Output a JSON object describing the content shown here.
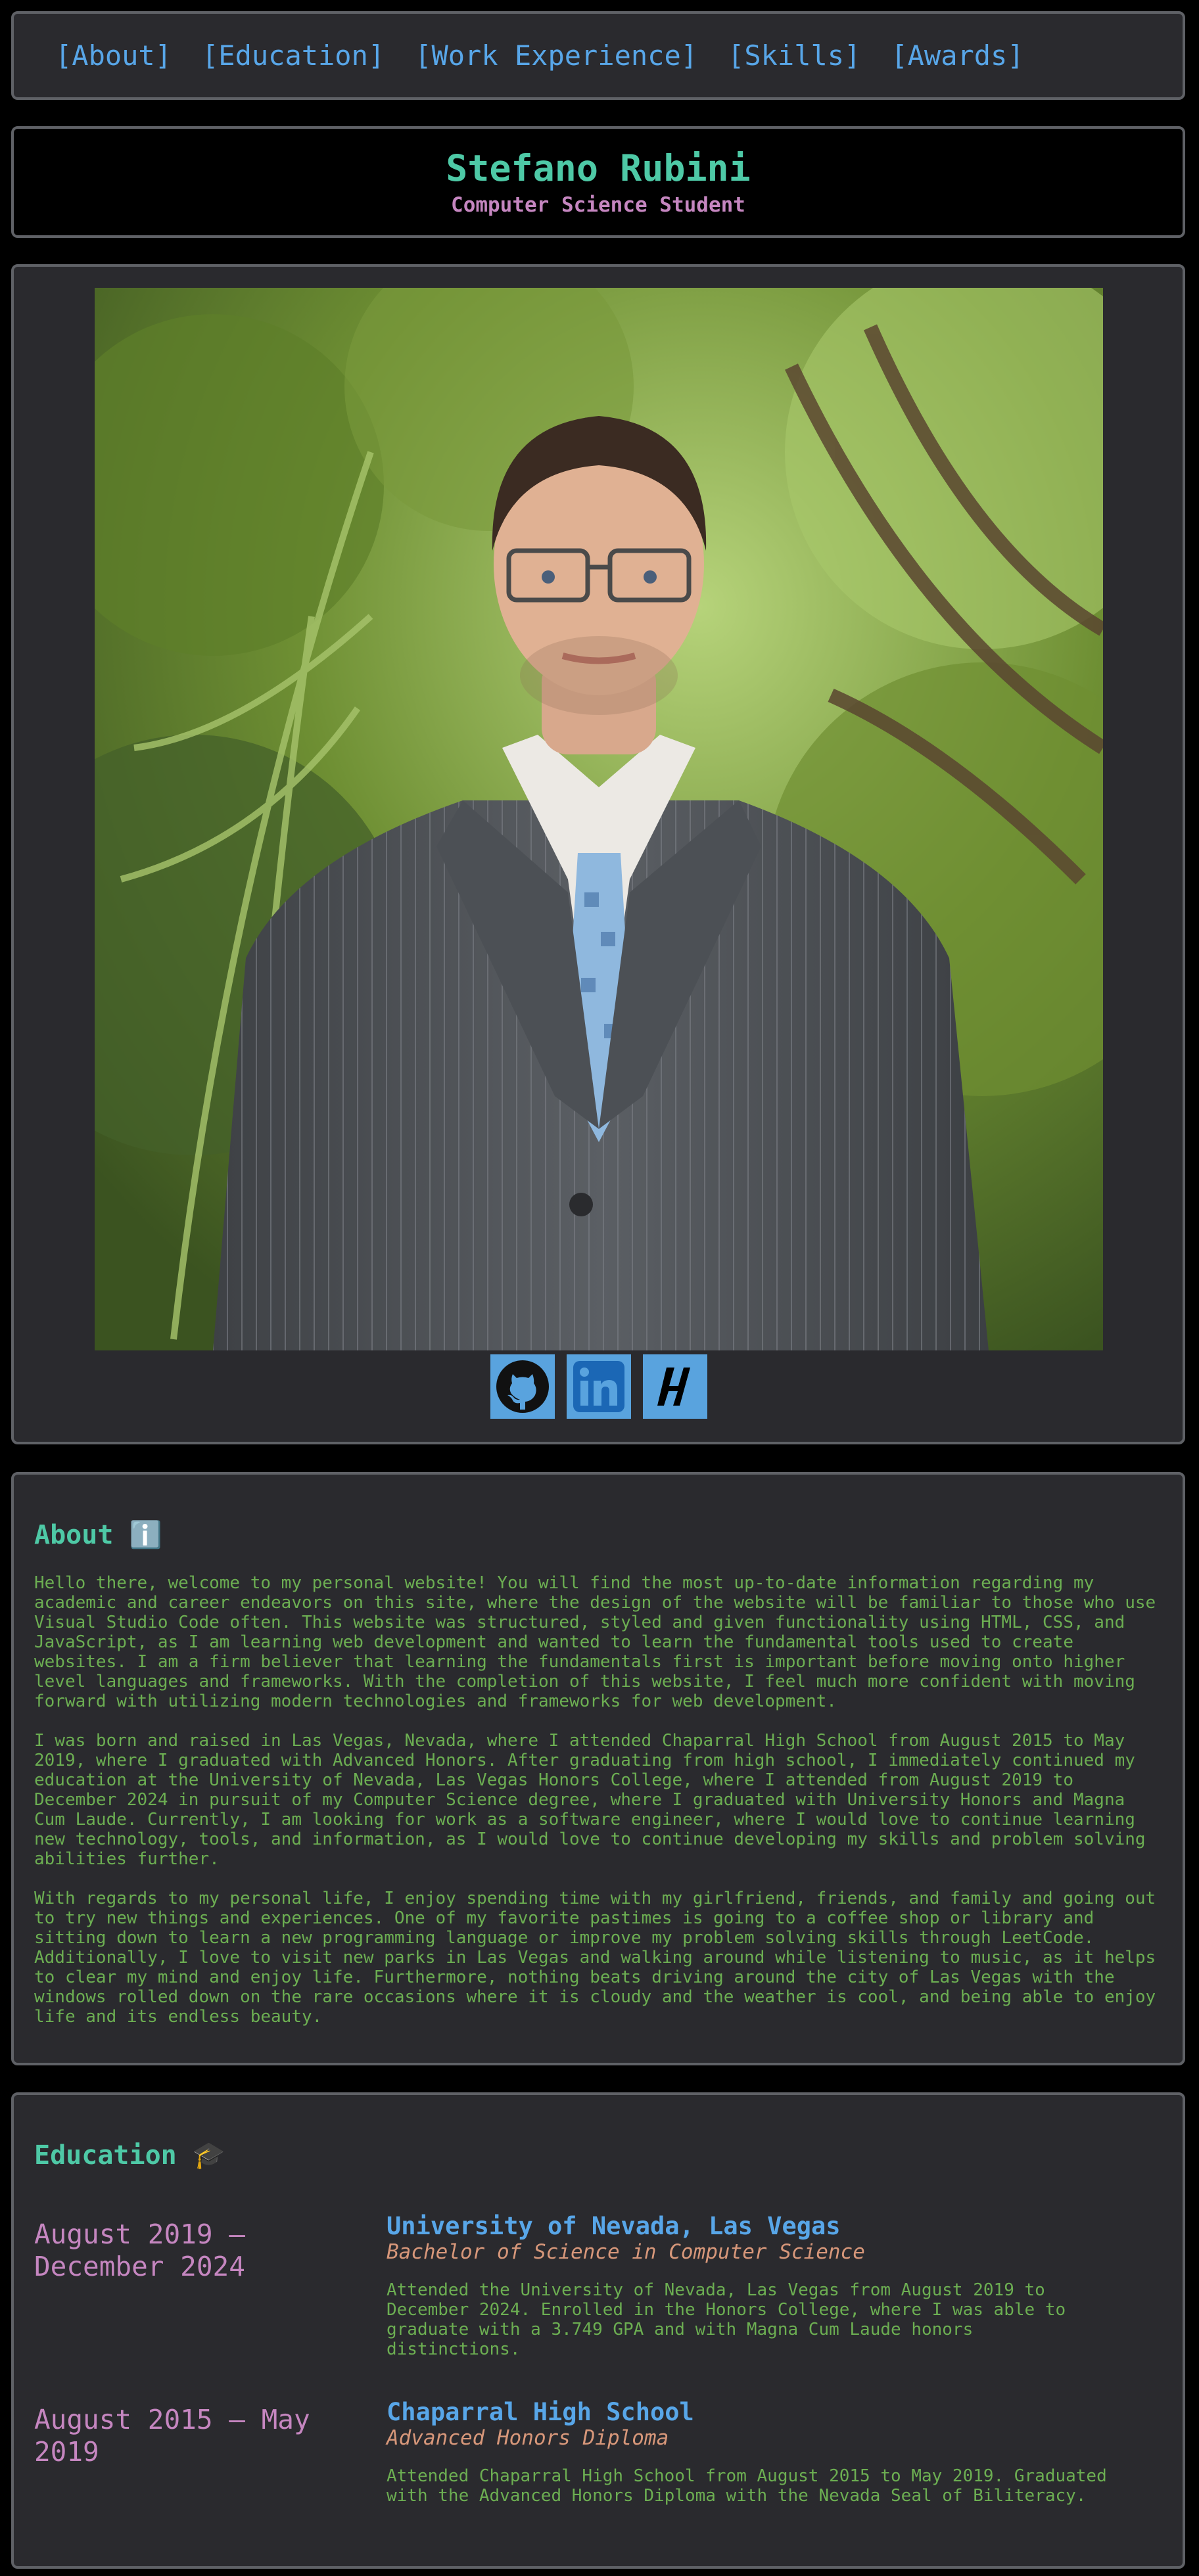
{
  "nav": {
    "items": [
      "[About]",
      "[Education]",
      "[Work Experience]",
      "[Skills]",
      "[Awards]"
    ]
  },
  "header": {
    "name": "Stefano Rubini",
    "role": "Computer Science Student"
  },
  "profile": {
    "photo_icon": "portrait-photo",
    "socials": [
      "github-icon",
      "linkedin-icon",
      "handshake-icon"
    ]
  },
  "about": {
    "title": "About ℹ️",
    "paragraphs": [
      "Hello there, welcome to my personal website! You will find the most up-to-date information regarding my academic and career endeavors on this site, where the design of the website will be familiar to those who use Visual Studio Code often. This website was structured, styled and given functionality using HTML, CSS, and JavaScript, as I am learning web development and wanted to learn the fundamental tools used to create websites. I am a firm believer that learning the fundamentals first is important before moving onto higher level languages and frameworks. With the completion of this website, I feel much more confident with moving forward with utilizing modern technologies and frameworks for web development.",
      "I was born and raised in Las Vegas, Nevada, where I attended Chaparral High School from August 2015 to May 2019, where I graduated with Advanced Honors. After graduating from high school, I immediately continued my education at the University of Nevada, Las Vegas Honors College, where I attended from August 2019 to December 2024 in pursuit of my Computer Science degree, where I graduated with University Honors and Magna Cum Laude. Currently, I am looking for work as a software engineer, where I would love to continue learning new technology, tools, and information, as I would love to continue developing my skills and problem solving abilities further.",
      "With regards to my personal life, I enjoy spending time with my girlfriend, friends, and family and going out to try new things and experiences. One of my favorite pastimes is going to a coffee shop or library and sitting down to learn a new programming language or improve my problem solving skills through LeetCode. Additionally, I love to visit new parks in Las Vegas and walking around while listening to music, as it helps to clear my mind and enjoy life. Furthermore, nothing beats driving around the city of Las Vegas with the windows rolled down on the rare occasions where it is cloudy and the weather is cool, and being able to enjoy life and its endless beauty."
    ]
  },
  "education": {
    "title": "Education 🎓",
    "entries": [
      {
        "date": "August 2019 – December 2024",
        "school": "University of Nevada, Las Vegas",
        "degree": "Bachelor of Science in Computer Science",
        "description": "Attended the University of Nevada, Las Vegas from August 2019 to December 2024. Enrolled in the Honors College, where I was able to graduate with a 3.749 GPA and with Magna Cum Laude honors distinctions."
      },
      {
        "date": "August 2015 – May 2019",
        "school": "Chaparral High School",
        "degree": "Advanced Honors Diploma",
        "description": "Attended Chaparral High School from August 2015 to May 2019. Graduated with the Advanced Honors Diploma with the Nevada Seal of Biliteracy."
      }
    ]
  }
}
